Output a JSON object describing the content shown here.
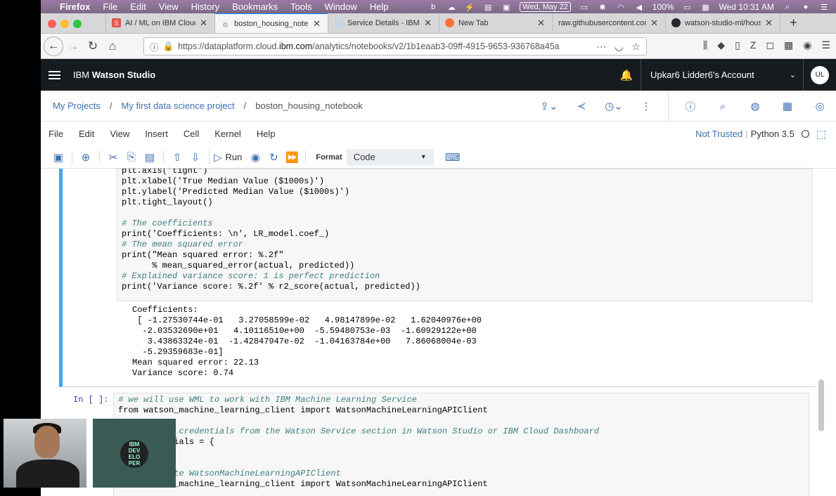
{
  "macbar": {
    "app": "Firefox",
    "menus": [
      "File",
      "Edit",
      "View",
      "History",
      "Bookmarks",
      "Tools",
      "Window",
      "Help"
    ],
    "date": "Wed, May 22",
    "battery": "100%",
    "clock": "Wed 10:31 AM"
  },
  "tabs": [
    {
      "title": "AI / ML on IBM Cloud",
      "fav_color": "#e2574c",
      "fav_letter": "S"
    },
    {
      "title": "boston_housing_notebo",
      "fav_color": "#ffffff",
      "fav_letter": "☼"
    },
    {
      "title": "Service Details - IBM C",
      "fav_color": "#c9d6e2",
      "fav_letter": ""
    },
    {
      "title": "New Tab",
      "fav_color": "#ff7139",
      "fav_letter": ""
    },
    {
      "title": "raw.githubusercontent.com",
      "fav_color": "#d7d7d9",
      "fav_letter": ""
    },
    {
      "title": "watson-studio-ml/hous",
      "fav_color": "#24292e",
      "fav_letter": ""
    }
  ],
  "url": {
    "prefix": "https://dataplatform.cloud.",
    "domain": "ibm.com",
    "path": "/analytics/notebooks/v2/1b1eaab3-09ff-4915-9653-936768a45a"
  },
  "studio": {
    "brand_prefix": "IBM ",
    "brand_name": "Watson Studio",
    "account": "Upkar6 Lidder6's Account",
    "avatar_initials": "UL"
  },
  "breadcrumb": {
    "projects": "My Projects",
    "project": "My first data science project",
    "notebook": "boston_housing_notebook"
  },
  "jupyter_menu": [
    "File",
    "Edit",
    "View",
    "Insert",
    "Cell",
    "Kernel",
    "Help"
  ],
  "kernel": {
    "trust": "Not Trusted",
    "name": "Python 3.5"
  },
  "toolbar": {
    "run": "Run",
    "format_label": "Format",
    "format_value": "Code"
  },
  "cell1_code": [
    "plt.axis('tight')",
    "plt.xlabel('True Median Value ($1000s)')",
    "plt.ylabel('Predicted Median Value ($1000s)')",
    "plt.tight_layout()",
    "",
    "# The coefficients",
    "print('Coefficients: \\n', LR_model.coef_)",
    "# The mean squared error",
    "print(\"Mean squared error: %.2f\"",
    "      % mean_squared_error(actual, predicted))",
    "# Explained variance score: 1 is perfect prediction",
    "print('Variance score: %.2f' % r2_score(actual, predicted))"
  ],
  "cell1_output": [
    "Coefficients: ",
    " [ -1.27530744e-01   3.27058599e-02   4.98147899e-02   1.62040976e+00",
    "  -2.03532690e+01   4.10116510e+00  -5.59480753e-03  -1.60929122e+00",
    "   3.43863324e-01  -1.42847947e-02  -1.04163784e+00   7.86068004e-03",
    "  -5.29359683e-01]",
    "Mean squared error: 22.13",
    "Variance score: 0.74"
  ],
  "cell2": {
    "prompt": "In [ ]:",
    "lines": [
      "# we will use WML to work with IBM Machine Learning Service",
      "from watson_machine_learning_client import WatsonMachineLearningAPIClient",
      "",
      "# Grab your credentials from the Watson Service section in Watson Studio or IBM Cloud Dashboard",
      "wml_credentials = {",
      "",
      "",
      "# Instantiate WatsonMachineLearningAPIClient",
      "from watson_machine_learning_client import WatsonMachineLearningAPIClient"
    ]
  },
  "overlay": {
    "badge": [
      "IBM",
      "DEV",
      "ELO",
      "PER"
    ]
  }
}
